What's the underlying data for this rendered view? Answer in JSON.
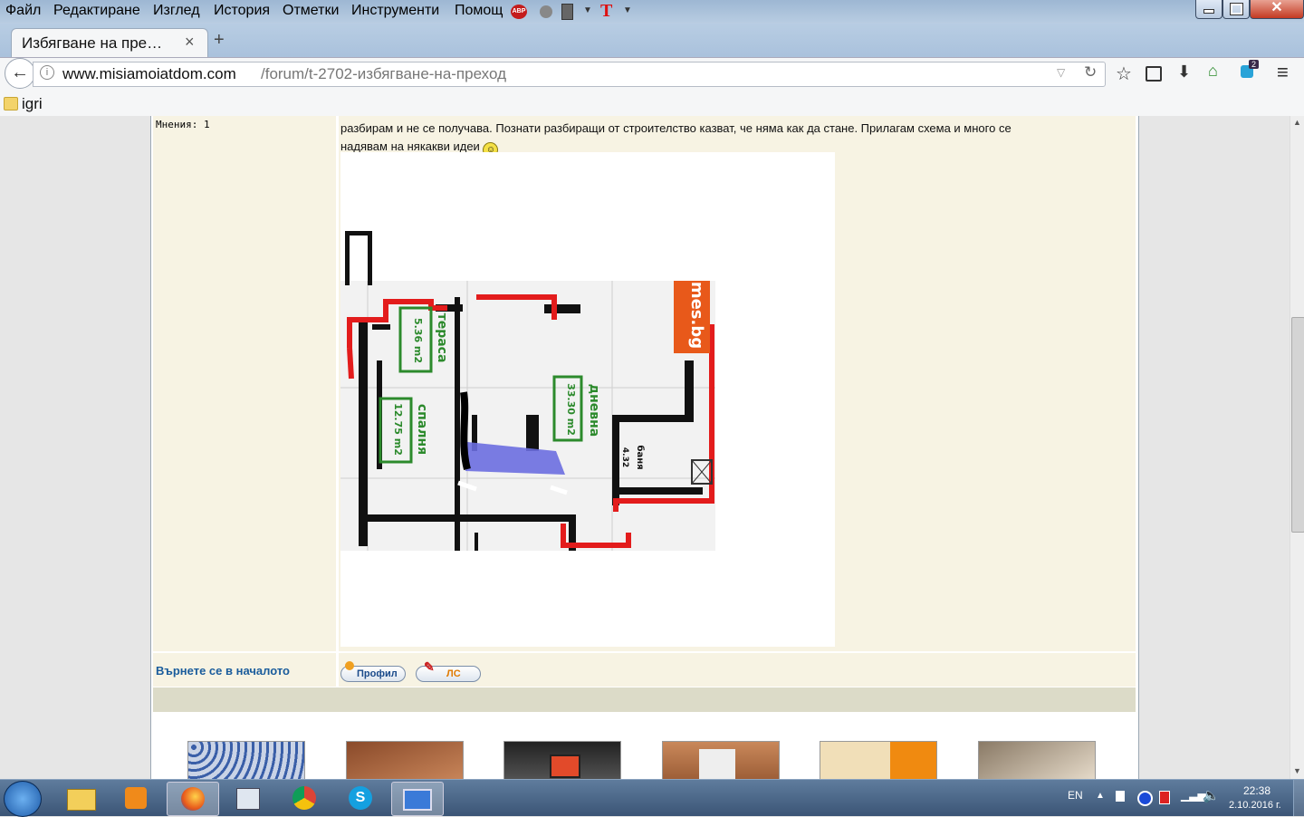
{
  "menu": {
    "items": [
      "Файл",
      "Редактиране",
      "Изглед",
      "История",
      "Отметки",
      "Инструменти",
      "Помощ"
    ],
    "addon_abp": "ABP"
  },
  "tab": {
    "title": "Избягване на пре…",
    "close": "×",
    "new": "+"
  },
  "address": {
    "domain": "www.misiamoiatdom.com",
    "path": "/forum/t-2702-избягване-на-преход",
    "notification_count": "2"
  },
  "bookmarks": {
    "folder": "igri"
  },
  "post": {
    "author_meta": "Мнения: 1",
    "text_line1": "разбирам и не се получава. Познати разбиращи от строителство казват, че няма как да стане. Прилагам схема и много се",
    "text_line2": "надявам на някакви идеи",
    "back_to_top": "Върнете се в началото",
    "profile_btn": "Профил",
    "pm_btn": "ЛС"
  },
  "plan": {
    "rooms": [
      {
        "name": "тераса",
        "area": "5.36 m2",
        "code": "E"
      },
      {
        "name": "дневна",
        "area": "33.30 m2",
        "code": "E"
      },
      {
        "name": "спалня",
        "area": "12.75 m2",
        "code": "E"
      },
      {
        "name": "баня",
        "area": "4.32",
        "code": ""
      }
    ],
    "watermark": "mes.bg"
  },
  "taskbar": {
    "lang": "EN",
    "time": "22:38",
    "date": "2.10.2016 г."
  },
  "colors": {
    "accent_link": "#1a5c9c",
    "post_bg": "#f7f3e3",
    "wall_red": "#e31c1c",
    "wall_black": "#111111",
    "highlight_blue": "#6b6ee0"
  }
}
